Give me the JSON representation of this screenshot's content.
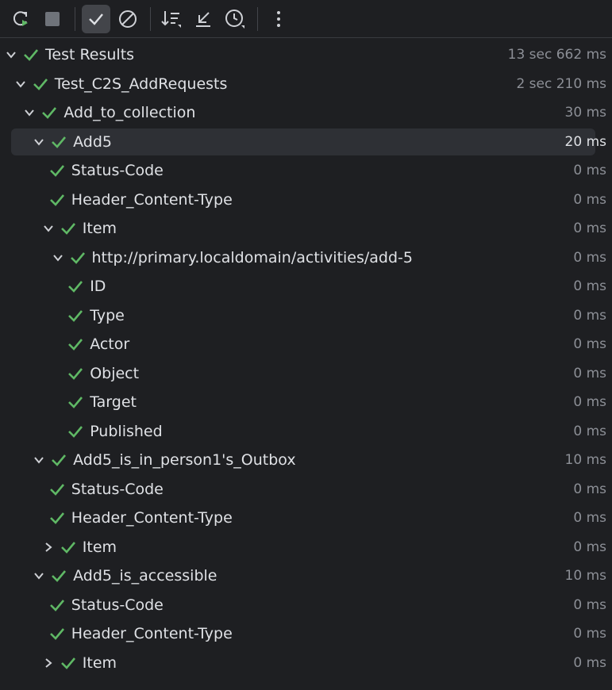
{
  "toolbar": {
    "buttons": [
      {
        "name": "rerun-icon"
      },
      {
        "name": "stop-icon"
      },
      {
        "name": "show-passed-icon",
        "active": true
      },
      {
        "name": "show-ignored-icon"
      },
      {
        "name": "sort-icon"
      },
      {
        "name": "collapse-icon"
      },
      {
        "name": "duration-icon"
      },
      {
        "name": "more-icon"
      }
    ]
  },
  "colors": {
    "background": "#1e1f22",
    "pass": "#5fb865",
    "text": "#dfe1e5",
    "muted": "#8c8f96",
    "selected_row": "#2e3035"
  },
  "tree": [
    {
      "label": "Test Results",
      "time": "13 sec 662 ms",
      "indent": 0,
      "chevron": "down"
    },
    {
      "label": "Test_C2S_AddRequests",
      "time": "2 sec 210 ms",
      "indent": 1,
      "chevron": "down"
    },
    {
      "label": "Add_to_collection",
      "time": "30 ms",
      "indent": 2,
      "chevron": "down"
    },
    {
      "label": "Add5",
      "time": "20 ms",
      "indent": 3,
      "chevron": "down",
      "selected": true
    },
    {
      "label": "Status-Code",
      "time": "0 ms",
      "indent": 4,
      "chevron": "none"
    },
    {
      "label": "Header_Content-Type",
      "time": "0 ms",
      "indent": 4,
      "chevron": "none"
    },
    {
      "label": "Item",
      "time": "0 ms",
      "indent": 4,
      "chevron": "down"
    },
    {
      "label": "http://primary.localdomain/activities/add-5",
      "time": "0 ms",
      "indent": 5,
      "chevron": "down"
    },
    {
      "label": "ID",
      "time": "0 ms",
      "indent": 6,
      "chevron": "none"
    },
    {
      "label": "Type",
      "time": "0 ms",
      "indent": 6,
      "chevron": "none"
    },
    {
      "label": "Actor",
      "time": "0 ms",
      "indent": 6,
      "chevron": "none"
    },
    {
      "label": "Object",
      "time": "0 ms",
      "indent": 6,
      "chevron": "none"
    },
    {
      "label": "Target",
      "time": "0 ms",
      "indent": 6,
      "chevron": "none"
    },
    {
      "label": "Published",
      "time": "0 ms",
      "indent": 6,
      "chevron": "none"
    },
    {
      "label": "Add5_is_in_person1's_Outbox",
      "time": "10 ms",
      "indent": 3,
      "chevron": "down"
    },
    {
      "label": "Status-Code",
      "time": "0 ms",
      "indent": 4,
      "chevron": "none"
    },
    {
      "label": "Header_Content-Type",
      "time": "0 ms",
      "indent": 4,
      "chevron": "none"
    },
    {
      "label": "Item",
      "time": "0 ms",
      "indent": 4,
      "chevron": "right"
    },
    {
      "label": "Add5_is_accessible",
      "time": "10 ms",
      "indent": 3,
      "chevron": "down"
    },
    {
      "label": "Status-Code",
      "time": "0 ms",
      "indent": 4,
      "chevron": "none"
    },
    {
      "label": "Header_Content-Type",
      "time": "0 ms",
      "indent": 4,
      "chevron": "none"
    },
    {
      "label": "Item",
      "time": "0 ms",
      "indent": 4,
      "chevron": "right"
    }
  ]
}
